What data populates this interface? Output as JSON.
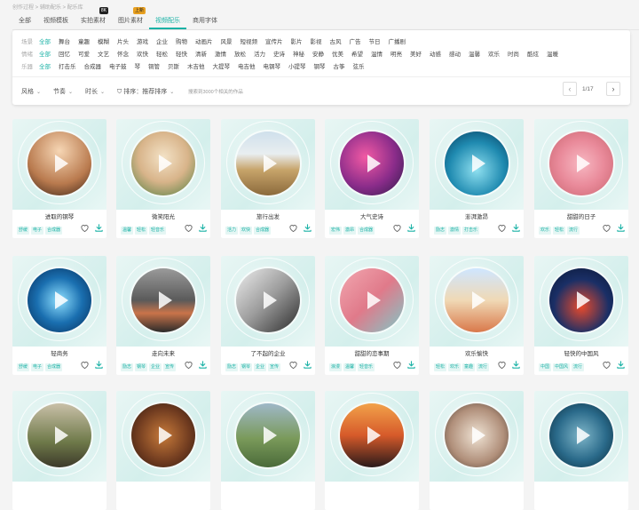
{
  "breadcrumb": "创作过程 > 辅助配乐 > 配乐库",
  "tabs": [
    {
      "label": "全部"
    },
    {
      "label": "视频模板"
    },
    {
      "label": "实拍素材",
      "badge": "8K"
    },
    {
      "label": "图片素材",
      "badge": "上新"
    },
    {
      "label": "视频配乐",
      "active": true
    },
    {
      "label": "商用字体"
    }
  ],
  "filters": {
    "row1": {
      "label": "场景",
      "options": [
        "全部",
        "舞台",
        "童趣",
        "模糊",
        "片头",
        "游戏",
        "企业",
        "购物",
        "动画片",
        "风景",
        "短视频",
        "宣传片",
        "影片",
        "影视",
        "古风",
        "广告",
        "节日",
        "广播剧"
      ],
      "selected": 0
    },
    "row2": {
      "label": "情绪",
      "options": [
        "全部",
        "回忆",
        "可爱",
        "文艺",
        "怀念",
        "欢快",
        "轻松",
        "轻快",
        "清新",
        "激情",
        "放松",
        "活力",
        "史诗",
        "神秘",
        "安静",
        "优美",
        "希望",
        "温情",
        "明亮",
        "美好",
        "动感",
        "感动",
        "温馨",
        "欢乐",
        "时尚",
        "酷炫",
        "温暖"
      ],
      "selected": 0
    },
    "row3": {
      "label": "乐器",
      "options": [
        "全部",
        "打击乐",
        "合成器",
        "电子鼓",
        "琴",
        "铜管",
        "贝斯",
        "木吉他",
        "大提琴",
        "电吉他",
        "电钢琴",
        "小提琴",
        "钢琴",
        "古筝",
        "弦乐"
      ],
      "selected": 0
    }
  },
  "toolbar": {
    "style_label": "风格",
    "tempo_label": "节奏",
    "duration_label": "时长",
    "sort_label": "排序：推荐排序",
    "note": "搜索到3000个相关的作品",
    "page": "1/17"
  },
  "cards": [
    {
      "title": "进取的钢琴",
      "tags": [
        "舒缓",
        "电子",
        "合成器"
      ]
    },
    {
      "title": "微笑阳光",
      "tags": [
        "温馨",
        "轻松",
        "轻音乐"
      ]
    },
    {
      "title": "旅行出发",
      "tags": [
        "活力",
        "欢快",
        "合成器"
      ]
    },
    {
      "title": "大气史诗",
      "tags": [
        "宏伟",
        "激昂",
        "合成器"
      ]
    },
    {
      "title": "澎湃激昂",
      "tags": [
        "励志",
        "激情",
        "打击乐"
      ]
    },
    {
      "title": "甜甜的日子",
      "tags": [
        "欢乐",
        "轻松",
        "流行"
      ]
    },
    {
      "title": "轻商务",
      "tags": [
        "舒缓",
        "电子",
        "合成器"
      ]
    },
    {
      "title": "走向未来",
      "tags": [
        "励志",
        "钢琴",
        "企业",
        "宣传"
      ]
    },
    {
      "title": "了不起的企业",
      "tags": [
        "励志",
        "钢琴",
        "企业",
        "宣传"
      ]
    },
    {
      "title": "甜甜的恋事期",
      "tags": [
        "浪漫",
        "温馨",
        "轻音乐"
      ]
    },
    {
      "title": "欢乐愉快",
      "tags": [
        "轻松",
        "欢乐",
        "童趣",
        "流行"
      ]
    },
    {
      "title": "轻快的中国风",
      "tags": [
        "中国",
        "中国风",
        "流行"
      ]
    },
    {
      "title": "",
      "tags": []
    },
    {
      "title": "",
      "tags": []
    },
    {
      "title": "",
      "tags": []
    },
    {
      "title": "",
      "tags": []
    },
    {
      "title": "",
      "tags": []
    },
    {
      "title": "",
      "tags": []
    }
  ],
  "accent": "#1bb2a6"
}
